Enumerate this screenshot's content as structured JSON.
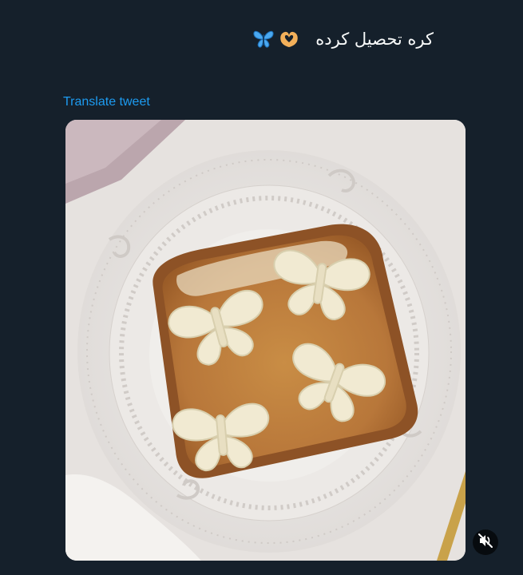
{
  "tweet": {
    "text": "کره تحصیل کرده",
    "emojis": [
      "butterfly-emoji",
      "heart-hands-emoji"
    ],
    "translate_label": "Translate tweet"
  },
  "media": {
    "type": "photo",
    "description_icon": "butterfly-butter-toast-photo",
    "mute_icon": "speaker-muted-icon"
  },
  "colors": {
    "background": "#15202b",
    "link": "#1d9bf0",
    "text": "#f7f9f9"
  }
}
